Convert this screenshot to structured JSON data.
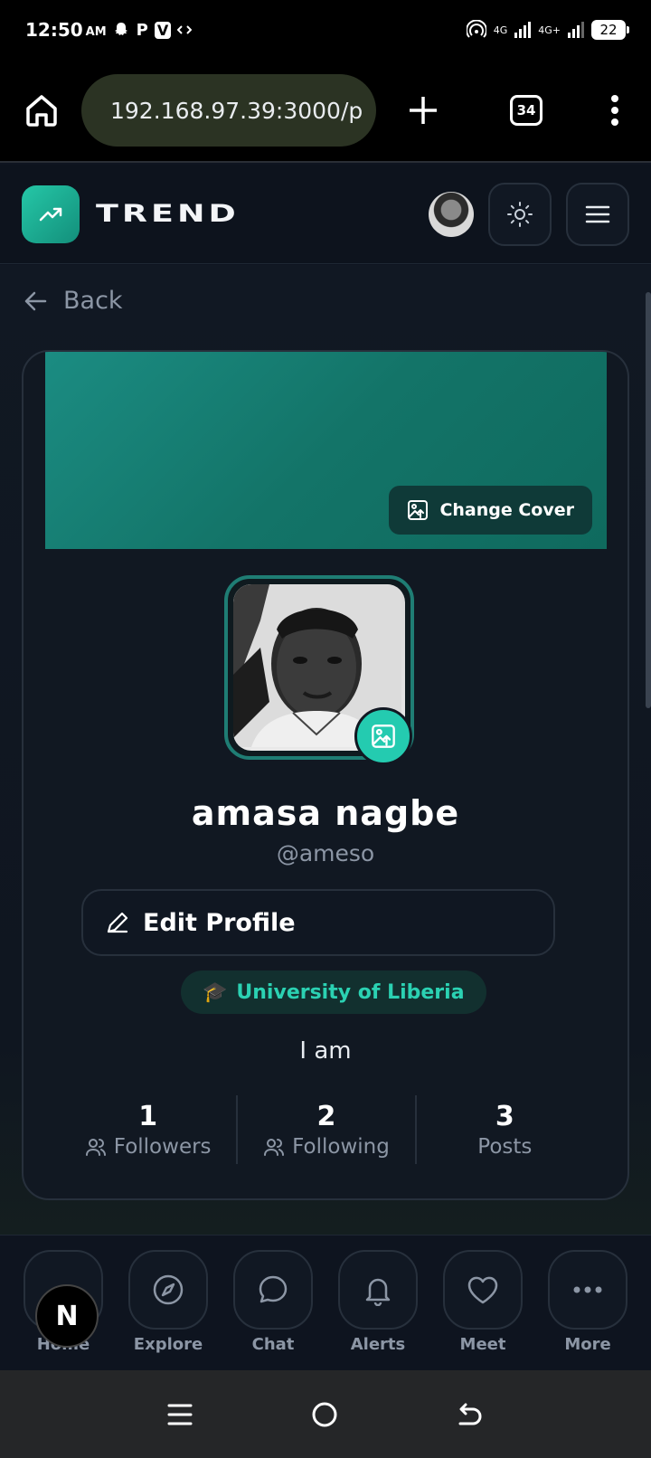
{
  "status_bar": {
    "time": "12:50",
    "ampm": "AM",
    "app_p": "P",
    "app_v": "V",
    "net1": "4G",
    "net2": "4G+",
    "battery": "22"
  },
  "browser": {
    "url": "192.168.97.39:3000/p",
    "tab_count": "34"
  },
  "header": {
    "brand": "TREND"
  },
  "page": {
    "back_label": "Back"
  },
  "profile": {
    "change_cover_label": "Change Cover",
    "name": "amasa nagbe",
    "handle": "@ameso",
    "edit_label": "Edit Profile",
    "university_emoji": "🎓",
    "university": "University of Liberia",
    "bio": "I am",
    "stats": [
      {
        "value": "1",
        "label": "Followers"
      },
      {
        "value": "2",
        "label": "Following"
      },
      {
        "value": "3",
        "label": "Posts"
      }
    ]
  },
  "bottom_nav": {
    "items": [
      {
        "label": "Home",
        "icon": "home-icon"
      },
      {
        "label": "Explore",
        "icon": "compass-icon"
      },
      {
        "label": "Chat",
        "icon": "chat-icon"
      },
      {
        "label": "Alerts",
        "icon": "bell-icon"
      },
      {
        "label": "Meet",
        "icon": "heart-icon"
      },
      {
        "label": "More",
        "icon": "more-icon"
      }
    ],
    "dev_badge": "N"
  },
  "colors": {
    "accent": "#24cbb0",
    "background": "#0e1420",
    "cover": "#137468"
  }
}
